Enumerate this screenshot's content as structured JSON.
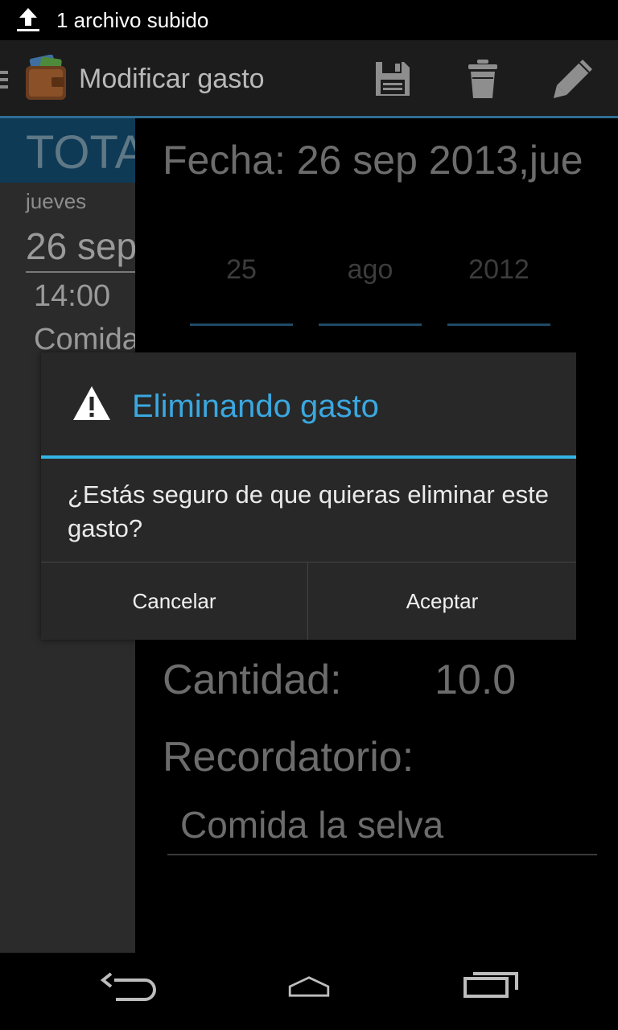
{
  "status_bar": {
    "notification_text": "1 archivo subido"
  },
  "action_bar": {
    "title": "Modificar gasto"
  },
  "list_pane": {
    "total_label": "TOTA",
    "item": {
      "day": "jueves",
      "date": "26 sep",
      "time": "14:00",
      "description": "Comida"
    }
  },
  "detail": {
    "date_label": "Fecha: 26 sep 2013,jue",
    "picker": {
      "day": "25",
      "month": "ago",
      "year": "2012"
    },
    "amount_label": "Cantidad:",
    "amount_value": "10.0",
    "reminder_label": "Recordatorio:",
    "reminder_value": "Comida la selva"
  },
  "dialog": {
    "title": "Eliminando gasto",
    "message": "¿Estás seguro de que quieras eliminar este gasto?",
    "cancel_label": "Cancelar",
    "accept_label": "Aceptar"
  },
  "colors": {
    "accent": "#33b5e5",
    "dialog_title": "#3aa8e0",
    "dialog_bg": "#282828",
    "list_bg": "#2b2b2b",
    "header_blue": "#0e3a56"
  },
  "icons": [
    "upload-icon",
    "menu-icon",
    "wallet-icon",
    "save-icon",
    "trash-icon",
    "edit-icon",
    "warning-icon",
    "back-icon",
    "home-icon",
    "recents-icon"
  ]
}
